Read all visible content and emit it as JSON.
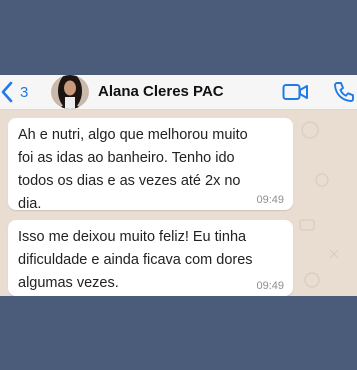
{
  "header": {
    "back_count": "3",
    "contact_name": "Alana Cleres PAC",
    "icons": {
      "back": "chevron-left-icon",
      "video": "video-camera-icon",
      "call": "phone-icon"
    }
  },
  "messages": [
    {
      "text": "Ah e nutri, algo que melhorou muito foi as idas ao banheiro. Tenho ido todos os dias e as vezes até 2x no dia.",
      "time": "09:49"
    },
    {
      "text": "Isso me deixou muito feliz! Eu tinha dificuldade e ainda ficava com dores algumas vezes.",
      "time": "09:49"
    }
  ],
  "colors": {
    "accent": "#1f7aea",
    "frame": "#4a5c7a",
    "chat_background": "#e9ddd1",
    "bubble": "#ffffff"
  }
}
